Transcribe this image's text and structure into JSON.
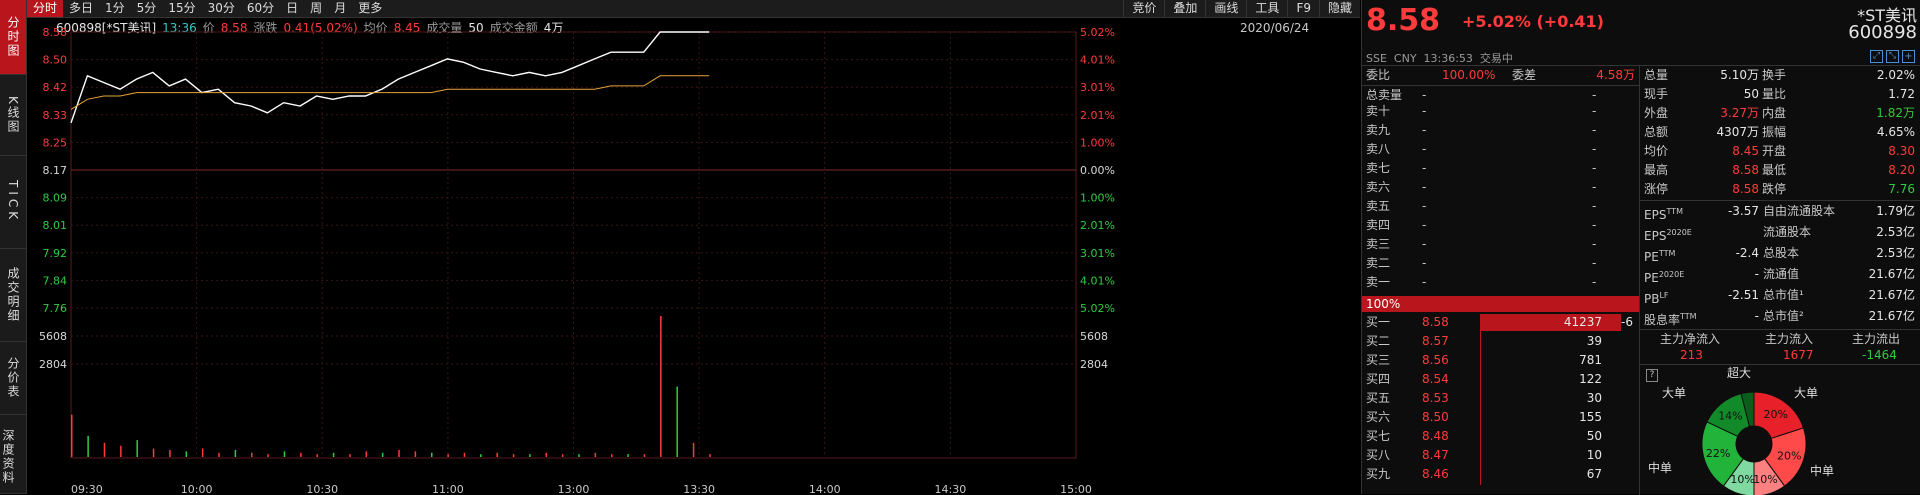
{
  "rail": [
    {
      "label": "分时图",
      "active": true
    },
    {
      "label": "K线图",
      "active": false
    },
    {
      "label": "TICK",
      "active": false
    },
    {
      "label": "成交明细",
      "active": false
    },
    {
      "label": "分价表",
      "active": false
    },
    {
      "label": "深度资料",
      "active": false
    }
  ],
  "toolbar": {
    "tabs": [
      "分时",
      "多日",
      "1分",
      "5分",
      "15分",
      "30分",
      "60分",
      "日",
      "周",
      "月",
      "更多"
    ],
    "active_tab": "分时",
    "right": [
      "竞价",
      "叠加",
      "画线",
      "工具",
      "F9",
      "隐藏"
    ]
  },
  "info": {
    "code_name": "600898[*ST美讯]",
    "time": "13:36",
    "price_label": "价",
    "price": "8.58",
    "chg_label": "涨跌",
    "chg": "0.41(5.02%)",
    "avg_label": "均价",
    "avg": "8.45",
    "vol_label": "成交量",
    "vol": "50",
    "amt_label": "成交金额",
    "amt": "4万",
    "date": "2020/06/24"
  },
  "chart_data": {
    "type": "line",
    "x_labels": [
      "09:30",
      "10:00",
      "10:30",
      "11:00",
      "13:00",
      "13:30",
      "14:00",
      "14:30",
      "15:00"
    ],
    "y_price_labels": [
      "8.58",
      "8.50",
      "8.42",
      "8.33",
      "8.25",
      "8.17",
      "8.09",
      "8.01",
      "7.92",
      "7.84",
      "7.76"
    ],
    "y_pct_labels": [
      "5.02%",
      "4.01%",
      "3.01%",
      "2.01%",
      "1.00%",
      "0.00%",
      "1.00%",
      "2.01%",
      "3.01%",
      "4.01%",
      "5.02%"
    ],
    "vol_labels": [
      "5608",
      "2804"
    ],
    "ylim": [
      7.76,
      8.58
    ],
    "prev_close": 8.17,
    "series": [
      {
        "values": [
          8.31,
          8.45,
          8.43,
          8.41,
          8.44,
          8.46,
          8.42,
          8.44,
          8.4,
          8.41,
          8.37,
          8.36,
          8.34,
          8.37,
          8.36,
          8.39,
          8.38,
          8.39,
          8.39,
          8.41,
          8.44,
          8.46,
          8.48,
          8.5,
          8.49,
          8.47,
          8.46,
          8.45,
          8.46,
          8.45,
          8.46,
          8.48,
          8.5,
          8.52,
          8.52,
          8.52,
          8.58,
          8.58,
          8.58,
          8.58
        ]
      },
      {
        "values": [
          8.35,
          8.38,
          8.39,
          8.39,
          8.4,
          8.4,
          8.4,
          8.4,
          8.4,
          8.4,
          8.4,
          8.4,
          8.4,
          8.4,
          8.4,
          8.4,
          8.4,
          8.4,
          8.4,
          8.4,
          8.4,
          8.4,
          8.4,
          8.41,
          8.41,
          8.41,
          8.41,
          8.41,
          8.41,
          8.41,
          8.41,
          8.41,
          8.41,
          8.42,
          8.42,
          8.42,
          8.45,
          8.45,
          8.45,
          8.45
        ]
      }
    ],
    "volume_fraction": [
      0.3,
      0.15,
      0.1,
      0.08,
      0.12,
      0.06,
      0.05,
      0.04,
      0.06,
      0.03,
      0.05,
      0.03,
      0.02,
      0.04,
      0.03,
      0.02,
      0.03,
      0.02,
      0.04,
      0.03,
      0.05,
      0.04,
      0.03,
      0.02,
      0.03,
      0.02,
      0.03,
      0.02,
      0.02,
      0.03,
      0.02,
      0.02,
      0.03,
      0.02,
      0.02,
      0.02,
      1.0,
      0.5,
      0.1,
      0.02
    ]
  },
  "quote": {
    "price": "8.58",
    "chg": "+5.02% (+0.41)",
    "name": "*ST美讯",
    "code": "600898",
    "sub": "SSE  CNY  13:36:53  交易中",
    "wei_label": "委比",
    "wei_bi": "100.00%",
    "wei_cha_label": "委差",
    "wei_cha": "4.58万",
    "sell_total_label": "总卖量",
    "sell_total": "-",
    "sells": [
      "卖十",
      "卖九",
      "卖八",
      "卖七",
      "卖六",
      "卖五",
      "卖四",
      "卖三",
      "卖二",
      "卖一"
    ],
    "sell_dash": "-",
    "bar_pct": "100%",
    "buys": [
      {
        "label": "买一",
        "price": "8.58",
        "vol": "41237",
        "chg": "-6"
      },
      {
        "label": "买二",
        "price": "8.57",
        "vol": "39",
        "chg": ""
      },
      {
        "label": "买三",
        "price": "8.56",
        "vol": "781",
        "chg": ""
      },
      {
        "label": "买四",
        "price": "8.54",
        "vol": "122",
        "chg": ""
      },
      {
        "label": "买五",
        "price": "8.53",
        "vol": "30",
        "chg": ""
      },
      {
        "label": "买六",
        "price": "8.50",
        "vol": "155",
        "chg": ""
      },
      {
        "label": "买七",
        "price": "8.48",
        "vol": "50",
        "chg": ""
      },
      {
        "label": "买八",
        "price": "8.47",
        "vol": "10",
        "chg": ""
      },
      {
        "label": "买九",
        "price": "8.46",
        "vol": "67",
        "chg": ""
      }
    ],
    "stats": [
      {
        "l1": "总量",
        "v1": "5.10万",
        "c1": "white",
        "l2": "换手",
        "v2": "2.02%",
        "c2": "white"
      },
      {
        "l1": "现手",
        "v1": "50",
        "c1": "white",
        "l2": "量比",
        "v2": "1.72",
        "c2": "white"
      },
      {
        "l1": "外盘",
        "v1": "3.27万",
        "c1": "red",
        "l2": "内盘",
        "v2": "1.82万",
        "c2": "green"
      },
      {
        "l1": "总额",
        "v1": "4307万",
        "c1": "white",
        "l2": "振幅",
        "v2": "4.65%",
        "c2": "white"
      },
      {
        "l1": "均价",
        "v1": "8.45",
        "c1": "red",
        "l2": "开盘",
        "v2": "8.30",
        "c2": "red"
      },
      {
        "l1": "最高",
        "v1": "8.58",
        "c1": "red",
        "l2": "最低",
        "v2": "8.20",
        "c2": "red"
      },
      {
        "l1": "涨停",
        "v1": "8.58",
        "c1": "red",
        "l2": "跌停",
        "v2": "7.76",
        "c2": "green"
      }
    ],
    "fin": [
      {
        "l1": "EPS",
        "s1": "TTM",
        "v1": "-3.57",
        "l2": "自由流通股本",
        "v2": "1.79亿"
      },
      {
        "l1": "EPS",
        "s1": "2020E",
        "v1": "",
        "l2": "流通股本",
        "v2": "2.53亿"
      },
      {
        "l1": "PE",
        "s1": "TTM",
        "v1": "-2.4",
        "l2": "总股本",
        "v2": "2.53亿"
      },
      {
        "l1": "PE",
        "s1": "2020E",
        "v1": "-",
        "l2": "流通值",
        "v2": "21.67亿"
      },
      {
        "l1": "PB",
        "s1": "LF",
        "v1": "-2.51",
        "l2": "总市值¹",
        "v2": "21.67亿"
      },
      {
        "l1": "股息率",
        "s1": "TTM",
        "v1": "-",
        "l2": "总市值²",
        "v2": "21.67亿"
      }
    ],
    "flow": {
      "l1": "主力净流入",
      "v1": "213",
      "l2": "主力流入",
      "v2": "1677",
      "l3": "主力流出",
      "v3": "-1464"
    },
    "pie": {
      "help": "?",
      "labels": {
        "super": "超大",
        "big_left": "大单",
        "big_right": "大单",
        "mid_left": "中单",
        "mid_right": "中单"
      },
      "slices": [
        {
          "pct": "20%",
          "value": 20,
          "color": "#e8202a"
        },
        {
          "pct": "20%",
          "value": 20,
          "color": "#ff4a4a"
        },
        {
          "pct": "10%",
          "value": 10,
          "color": "#ff8080"
        },
        {
          "pct": "10%",
          "value": 10,
          "color": "#7fd9a0"
        },
        {
          "pct": "22%",
          "value": 22,
          "color": "#22b33a"
        },
        {
          "pct": "14%",
          "value": 14,
          "color": "#138a2a"
        },
        {
          "pct": "",
          "value": 4,
          "color": "#0b5d1c"
        }
      ]
    },
    "colors": {
      "up": "#ff3b3b",
      "down": "#2ecc40",
      "accent": "#b8161c"
    }
  }
}
